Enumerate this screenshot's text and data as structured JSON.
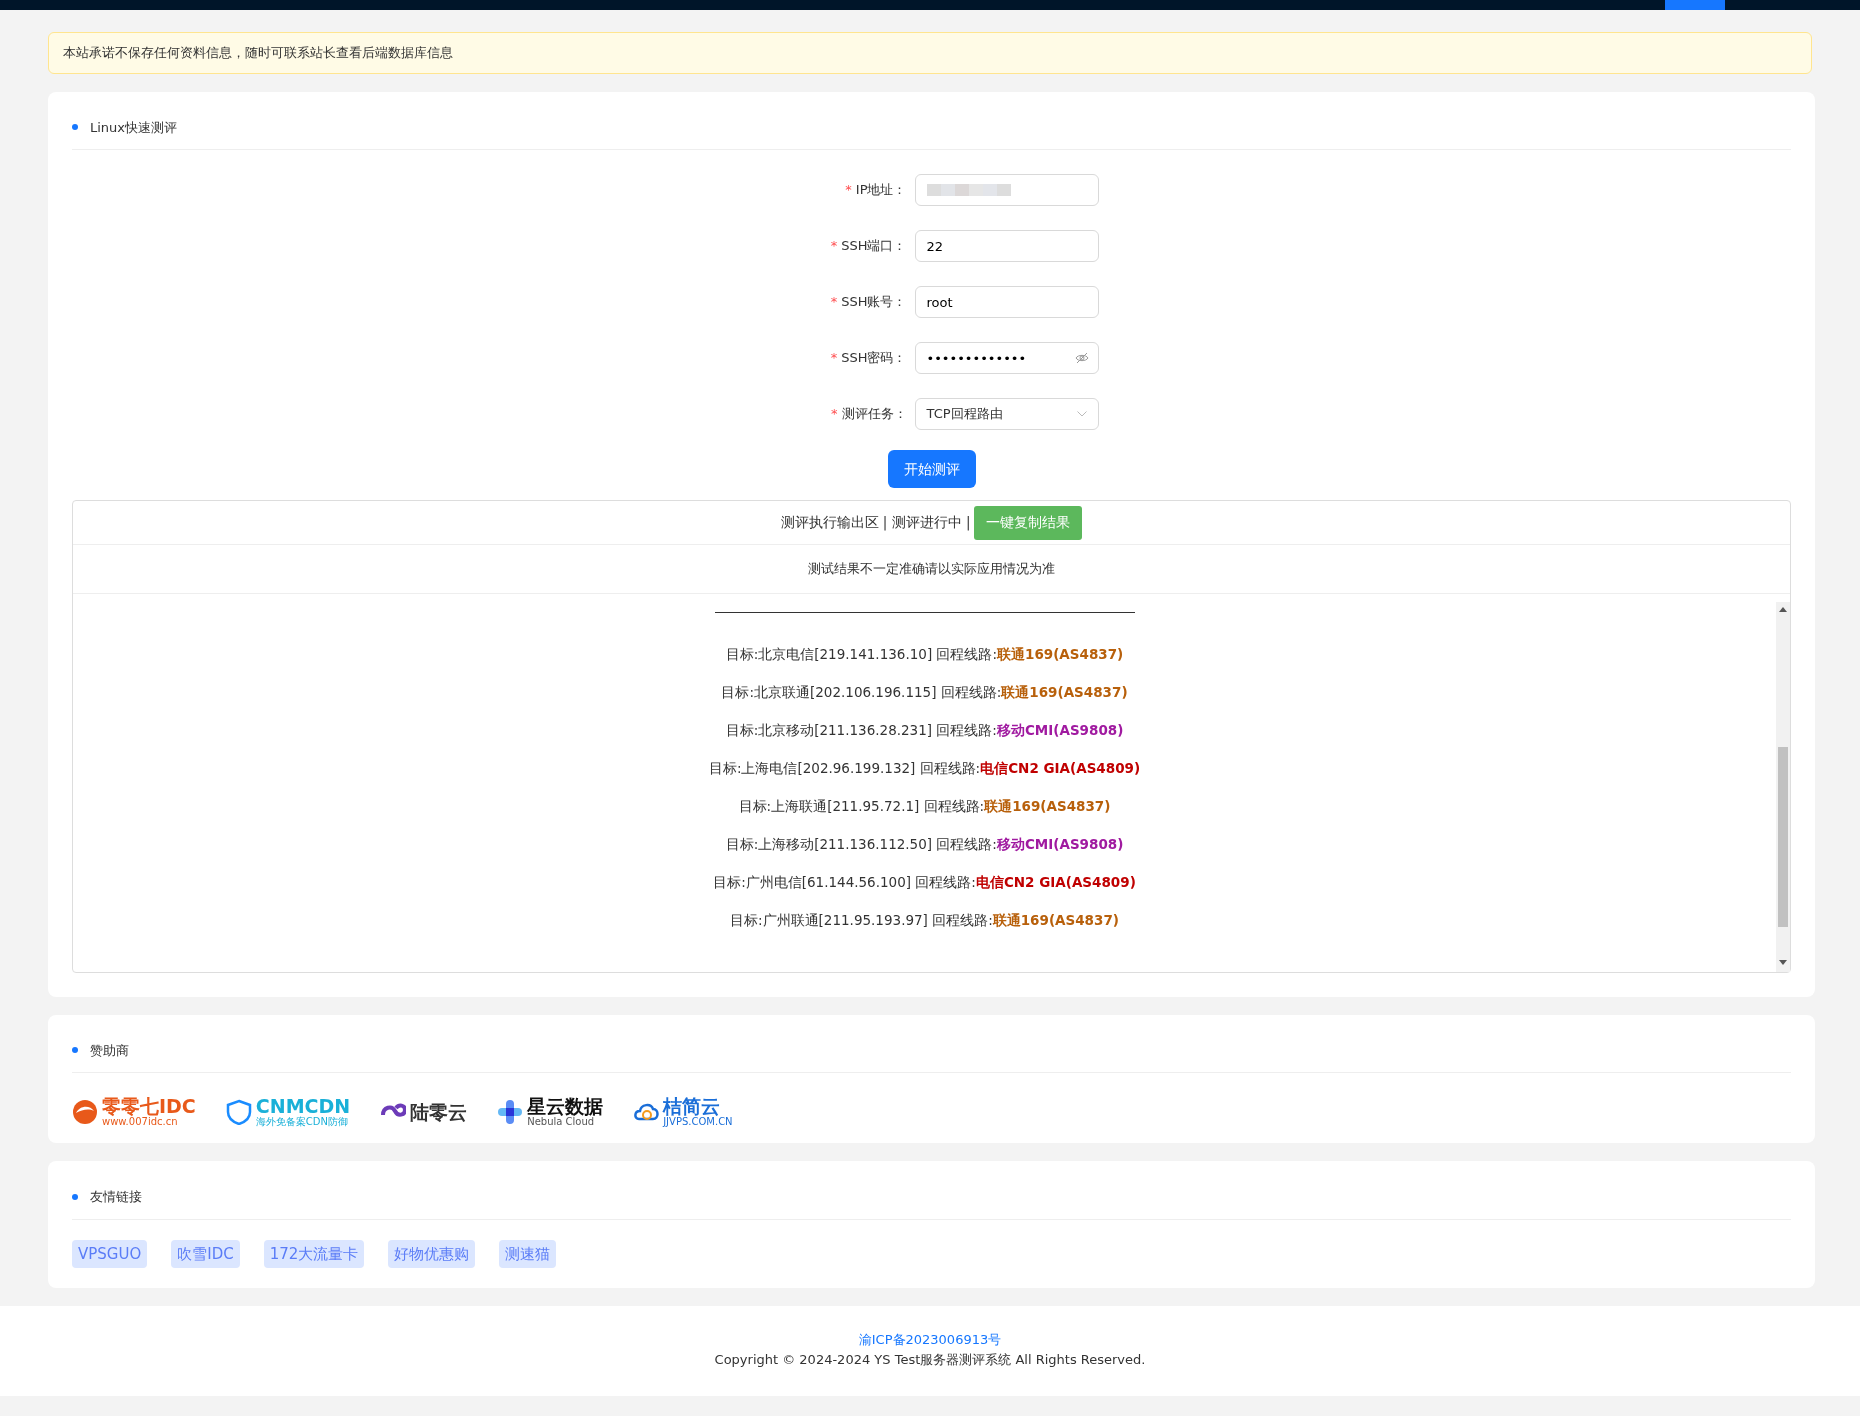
{
  "notice": "本站承诺不保存任何资料信息，随时可联系站长查看后端数据库信息",
  "test_card": {
    "title": "Linux快速测评",
    "fields": [
      {
        "label": "IP地址：",
        "required_mark": "*",
        "kind": "input",
        "redacted": true
      },
      {
        "label": "SSH端口：",
        "required_mark": "*",
        "kind": "input",
        "value": "22"
      },
      {
        "label": "SSH账号：",
        "required_mark": "*",
        "kind": "input",
        "value": "root"
      },
      {
        "label": "SSH密码：",
        "required_mark": "*",
        "kind": "password",
        "value": "•••••••••••••"
      },
      {
        "label": "测评任务：",
        "required_mark": "*",
        "kind": "select",
        "value": "TCP回程路由"
      }
    ],
    "submit": "开始测评",
    "output": {
      "status": "测评执行输出区 | 测评进行中 |",
      "copy_button": "一键复制结果",
      "disclaimer": "测试结果不一定准确请以实际应用情况为准",
      "lines": [
        {
          "target": "目标:北京电信[219.141.136.10] 回程线路:",
          "route": "联通169(AS4837)",
          "color": "#b8600b"
        },
        {
          "target": "目标:北京联通[202.106.196.115] 回程线路:",
          "route": "联通169(AS4837)",
          "color": "#b8600b"
        },
        {
          "target": "目标:北京移动[211.136.28.231] 回程线路:",
          "route": "移动CMI(AS9808)",
          "color": "#a01aa0"
        },
        {
          "target": "目标:上海电信[202.96.199.132] 回程线路:",
          "route": "电信CN2 GIA(AS4809)",
          "color": "#c00000"
        },
        {
          "target": "目标:上海联通[211.95.72.1] 回程线路:",
          "route": "联通169(AS4837)",
          "color": "#b8600b"
        },
        {
          "target": "目标:上海移动[211.136.112.50] 回程线路:",
          "route": "移动CMI(AS9808)",
          "color": "#a01aa0"
        },
        {
          "target": "目标:广州电信[61.144.56.100] 回程线路:",
          "route": "电信CN2 GIA(AS4809)",
          "color": "#c00000"
        },
        {
          "target": "目标:广州联通[211.95.193.97] 回程线路:",
          "route": "联通169(AS4837)",
          "color": "#b8600b"
        }
      ]
    }
  },
  "sponsors": {
    "title": "赞助商",
    "logos": [
      {
        "kind": "idc",
        "name": "零零七IDC",
        "sub": "www.007idc.cn"
      },
      {
        "kind": "cdn",
        "name": "CNMCDN",
        "sub": "海外免备案CDN防御"
      },
      {
        "kind": "cloud",
        "name": "陆零云"
      },
      {
        "kind": "plus",
        "name": "星云数据",
        "sub": "Nebula Cloud"
      },
      {
        "kind": "jj",
        "name": "桔简云",
        "sub": "JJVPS.COM.CN"
      }
    ]
  },
  "links": {
    "title": "友情链接",
    "items": [
      "VPSGUO",
      "吹雪IDC",
      "172大流量卡",
      "好物优惠购",
      "测速猫"
    ]
  },
  "footer": {
    "icp": "渝ICP备2023006913号",
    "copyright": "Copyright © 2024-2024 YS Test服务器测评系统 All Rights Reserved."
  }
}
